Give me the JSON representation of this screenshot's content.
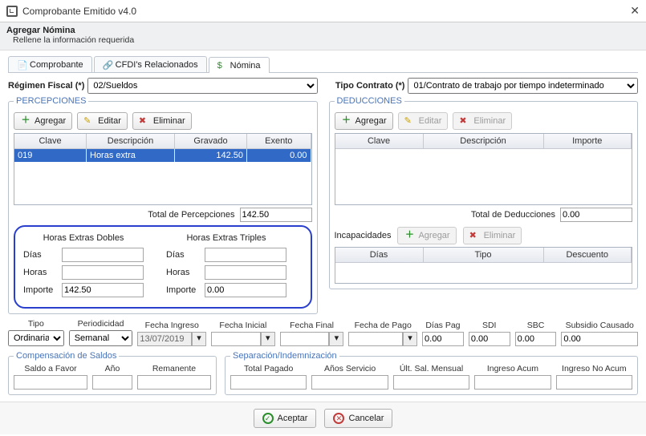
{
  "window": {
    "title": "Comprobante Emitido v4.0"
  },
  "subheader": {
    "title": "Agregar Nómina",
    "desc": "Rellene la información requerida"
  },
  "tabs": {
    "t0": "Comprobante",
    "t1": "CFDI's Relacionados",
    "t2": "Nómina"
  },
  "form": {
    "regimen_label": "Régimen Fiscal (*)",
    "regimen_value": "02/Sueldos",
    "tipocontrato_label": "Tipo Contrato (*)",
    "tipocontrato_value": "01/Contrato de trabajo por tiempo indeterminado"
  },
  "percepciones": {
    "legend": "PERCEPCIONES",
    "buttons": {
      "add": "Agregar",
      "edit": "Editar",
      "del": "Eliminar"
    },
    "cols": {
      "clave": "Clave",
      "desc": "Descripción",
      "grav": "Gravado",
      "ex": "Exento"
    },
    "rows": [
      {
        "clave": "019",
        "desc": "Horas extra",
        "grav": "142.50",
        "ex": "0.00"
      }
    ],
    "total_label": "Total de Percepciones",
    "total_value": "142.50"
  },
  "deducciones": {
    "legend": "DEDUCCIONES",
    "buttons": {
      "add": "Agregar",
      "edit": "Editar",
      "del": "Eliminar"
    },
    "cols": {
      "clave": "Clave",
      "desc": "Descripción",
      "imp": "Importe"
    },
    "total_label": "Total de Deducciones",
    "total_value": "0.00"
  },
  "horas_extra": {
    "dobles_title": "Horas Extras Dobles",
    "triples_title": "Horas Extras Triples",
    "dias": "Días",
    "horas": "Horas",
    "importe": "Importe",
    "d_dias": "",
    "d_horas": "",
    "d_importe": "142.50",
    "t_dias": "",
    "t_horas": "",
    "t_importe": "0.00"
  },
  "incapacidades": {
    "label": "Incapacidades",
    "add": "Agregar",
    "del": "Eliminar",
    "cols": {
      "dias": "Días",
      "tipo": "Tipo",
      "desc": "Descuento"
    }
  },
  "bottom": {
    "tipo_l": "Tipo",
    "tipo_v": "Ordinaria",
    "period_l": "Periodicidad",
    "period_v": "Semanal",
    "fingreso_l": "Fecha Ingreso",
    "fingreso_v": "13/07/2019",
    "finicial_l": "Fecha Inicial",
    "finicial_v": "",
    "ffinal_l": "Fecha Final",
    "ffinal_v": "",
    "fpago_l": "Fecha de Pago",
    "fpago_v": "",
    "diaspag_l": "Días Pag",
    "diaspag_v": "0.00",
    "sdi_l": "SDI",
    "sdi_v": "0.00",
    "sbc_l": "SBC",
    "sbc_v": "0.00",
    "subcau_l": "Subsidio Causado",
    "subcau_v": "0.00"
  },
  "comp": {
    "legend": "Compensación de Saldos",
    "saldo_l": "Saldo a Favor",
    "saldo_v": "",
    "anio_l": "Año",
    "anio_v": "",
    "rem_l": "Remanente",
    "rem_v": ""
  },
  "sep": {
    "legend": "Separación/Indemnización",
    "tp_l": "Total Pagado",
    "tp_v": "",
    "as_l": "Años Servicio",
    "as_v": "",
    "usm_l": "Últ. Sal. Mensual",
    "usm_v": "",
    "ia_l": "Ingreso Acum",
    "ia_v": "",
    "ina_l": "Ingreso No Acum",
    "ina_v": ""
  },
  "footer": {
    "ok": "Aceptar",
    "cancel": "Cancelar"
  }
}
